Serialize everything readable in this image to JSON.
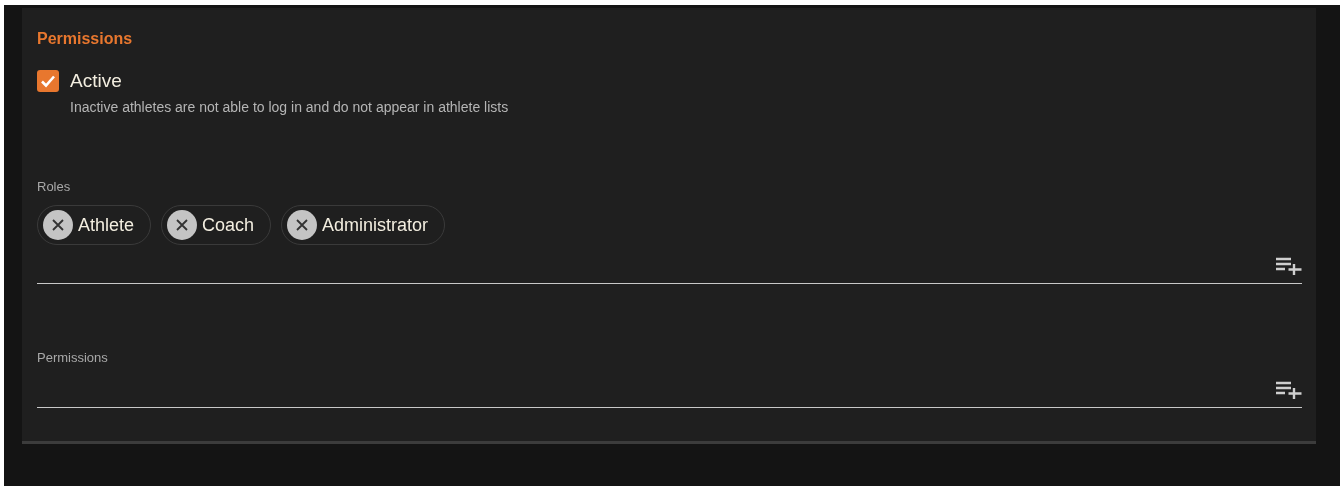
{
  "section_title": "Permissions",
  "active": {
    "label": "Active",
    "checked": true,
    "hint": "Inactive athletes are not able to log in and do not appear in athlete lists"
  },
  "fields": [
    {
      "label": "Roles",
      "chips": [
        {
          "label": "Athlete"
        },
        {
          "label": "Coach"
        },
        {
          "label": "Administrator"
        }
      ]
    },
    {
      "label": "Permissions"
    }
  ]
}
